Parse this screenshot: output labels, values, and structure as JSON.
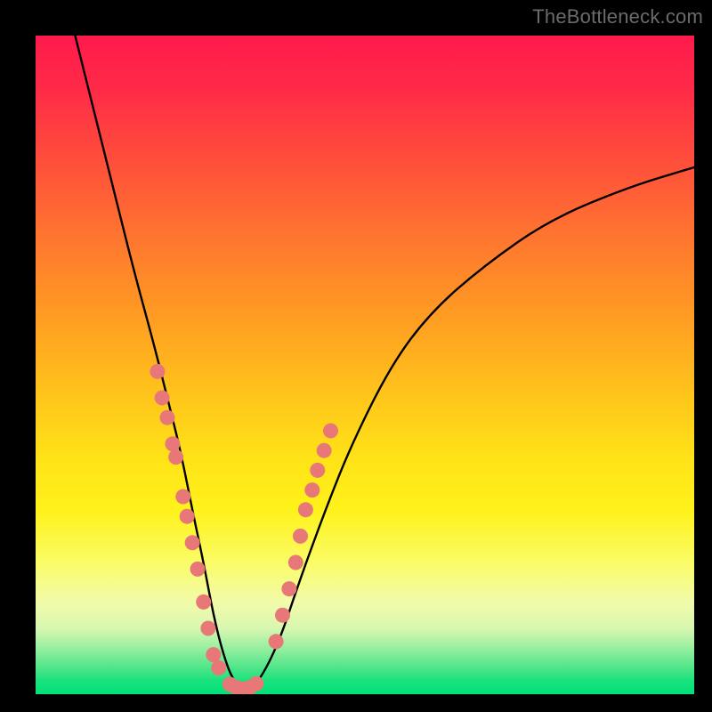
{
  "watermark": "TheBottleneck.com",
  "chart_data": {
    "type": "line",
    "title": "",
    "xlabel": "",
    "ylabel": "",
    "xlim": [
      0,
      100
    ],
    "ylim": [
      0,
      100
    ],
    "grid": false,
    "legend": false,
    "background_gradient_stops": [
      {
        "stop": 0,
        "color": "#ff1a4d"
      },
      {
        "stop": 32,
        "color": "#ff7a2e"
      },
      {
        "stop": 64,
        "color": "#ffe218"
      },
      {
        "stop": 86,
        "color": "#f2fbaa"
      },
      {
        "stop": 100,
        "color": "#00e07a"
      }
    ],
    "series": [
      {
        "name": "bottleneck-curve",
        "x": [
          6,
          9,
          12,
          15,
          18,
          20,
          22,
          24,
          25.5,
          27,
          28.5,
          30,
          32,
          34,
          37,
          40,
          44,
          48,
          54,
          60,
          68,
          78,
          90,
          100
        ],
        "values": [
          100,
          88,
          76,
          64,
          53,
          45,
          37,
          27,
          20,
          12,
          6,
          2,
          0.5,
          2,
          8,
          17,
          28,
          38,
          50,
          58,
          65,
          72,
          77,
          80
        ]
      }
    ],
    "markers": [
      {
        "name": "left-cluster",
        "points_x": [
          18.5,
          19.2,
          20.0,
          20.8,
          21.3,
          22.4,
          23.0,
          23.8,
          24.6,
          25.5,
          26.2,
          27.0,
          27.8
        ],
        "points_y": [
          49,
          45,
          42,
          38,
          36,
          30,
          27,
          23,
          19,
          14,
          10,
          6,
          4
        ],
        "color": "#e77877"
      },
      {
        "name": "bottom-cluster",
        "points_x": [
          29.5,
          30.5,
          31.5,
          32.5,
          33.5
        ],
        "points_y": [
          1.5,
          1.0,
          0.8,
          1.0,
          1.6
        ],
        "color": "#e77877"
      },
      {
        "name": "right-cluster",
        "points_x": [
          36.5,
          37.5,
          38.5,
          39.5,
          40.2,
          41.0,
          42.0,
          42.8,
          43.8,
          44.8
        ],
        "points_y": [
          8,
          12,
          16,
          20,
          24,
          28,
          31,
          34,
          37,
          40
        ],
        "color": "#e77877"
      }
    ]
  }
}
